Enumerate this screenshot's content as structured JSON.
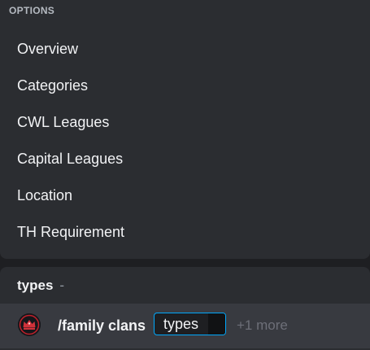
{
  "options": {
    "header": "OPTIONS",
    "items": [
      {
        "label": "Overview"
      },
      {
        "label": "Categories"
      },
      {
        "label": "CWL Leagues"
      },
      {
        "label": "Capital Leagues"
      },
      {
        "label": "Location"
      },
      {
        "label": "TH Requirement"
      }
    ]
  },
  "hint": {
    "title": "types",
    "dash": "-",
    "avatar_icon": "crown-emblem-icon",
    "command": "/family clans",
    "param_name": "types",
    "more": "+1 more"
  },
  "colors": {
    "accent_border": "#00a8fc",
    "panel_bg": "#2b2d31",
    "selected_row_bg": "#383a40"
  }
}
